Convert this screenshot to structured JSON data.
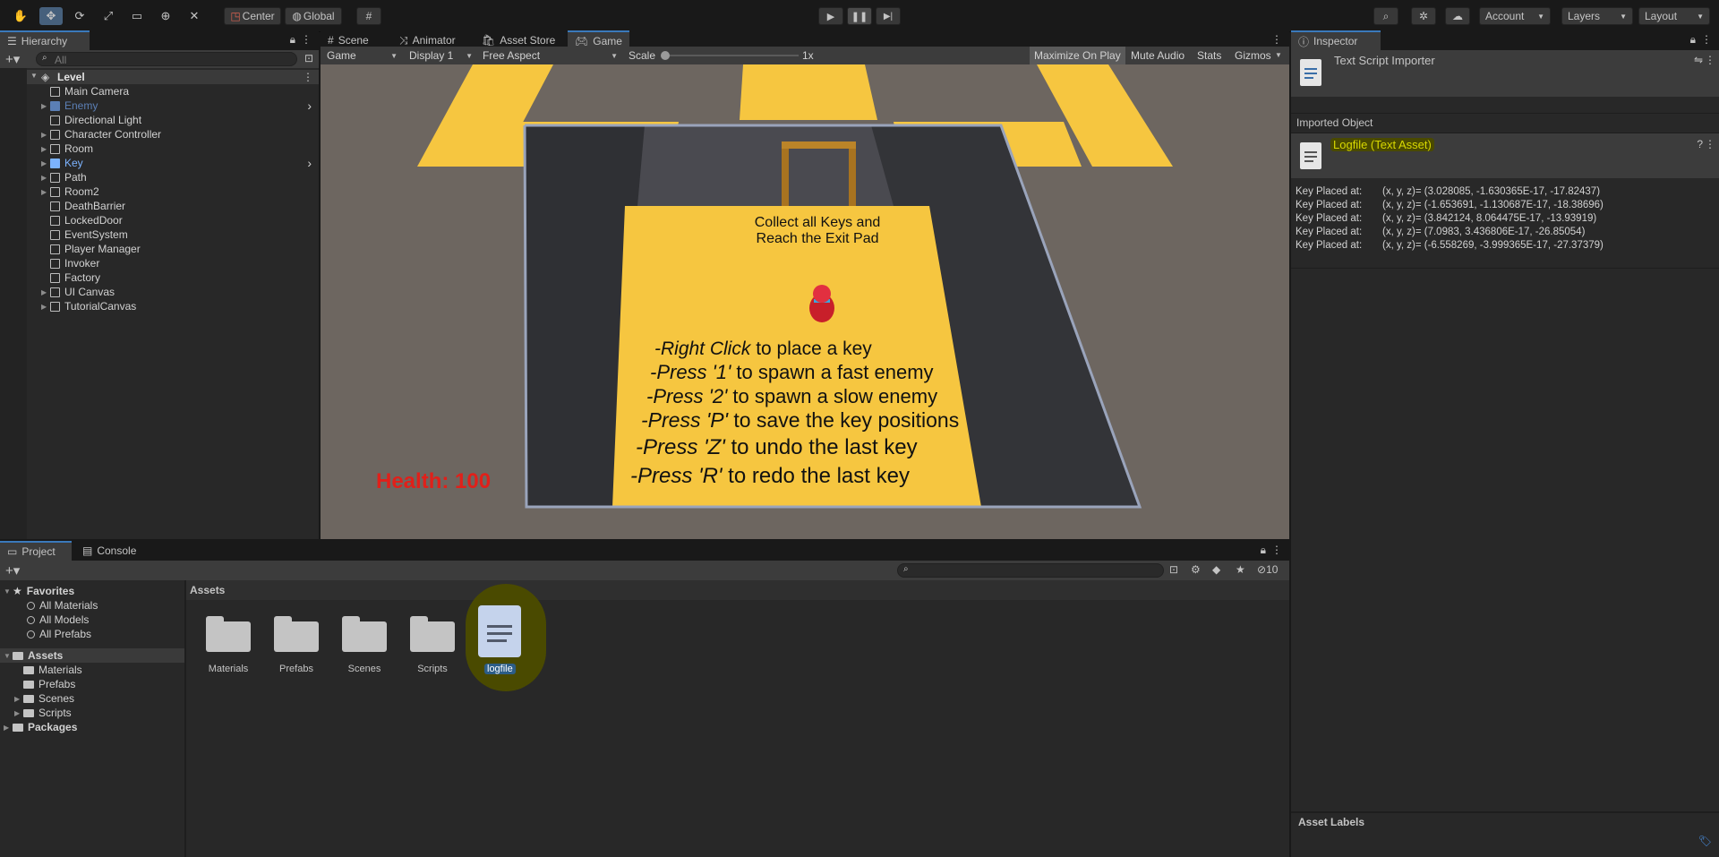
{
  "toolbar": {
    "pivot_label": "Center",
    "space_label": "Global",
    "account_label": "Account",
    "layers_label": "Layers",
    "layout_label": "Layout"
  },
  "hierarchy": {
    "tab_label": "Hierarchy",
    "search_placeholder": "All",
    "root": "Level",
    "items": [
      {
        "label": "Main Camera",
        "expandable": false,
        "color": "#d2d2d2"
      },
      {
        "label": "Enemy",
        "expandable": true,
        "color": "#5b7fb5"
      },
      {
        "label": "Directional Light",
        "expandable": false,
        "color": "#d2d2d2"
      },
      {
        "label": "Character Controller",
        "expandable": true,
        "color": "#d2d2d2"
      },
      {
        "label": "Room",
        "expandable": true,
        "color": "#d2d2d2"
      },
      {
        "label": "Key",
        "expandable": true,
        "color": "#7cb3ff"
      },
      {
        "label": "Path",
        "expandable": true,
        "color": "#d2d2d2"
      },
      {
        "label": "Room2",
        "expandable": true,
        "color": "#d2d2d2"
      },
      {
        "label": "DeathBarrier",
        "expandable": false,
        "color": "#d2d2d2"
      },
      {
        "label": "LockedDoor",
        "expandable": false,
        "color": "#d2d2d2"
      },
      {
        "label": "EventSystem",
        "expandable": false,
        "color": "#d2d2d2"
      },
      {
        "label": "Player Manager",
        "expandable": false,
        "color": "#d2d2d2"
      },
      {
        "label": "Invoker",
        "expandable": false,
        "color": "#d2d2d2"
      },
      {
        "label": "Factory",
        "expandable": false,
        "color": "#d2d2d2"
      },
      {
        "label": "UI Canvas",
        "expandable": true,
        "color": "#d2d2d2"
      },
      {
        "label": "TutorialCanvas",
        "expandable": true,
        "color": "#d2d2d2"
      }
    ]
  },
  "center_tabs": {
    "scene": "Scene",
    "animator": "Animator",
    "asset_store": "Asset Store",
    "game": "Game"
  },
  "game_toolbar": {
    "view": "Game",
    "display": "Display 1",
    "aspect": "Free Aspect",
    "scale_label": "Scale",
    "scale_value": "1x",
    "maximize": "Maximize On Play",
    "mute": "Mute Audio",
    "stats": "Stats",
    "gizmos": "Gizmos"
  },
  "game_view": {
    "objective_line1": "Collect all Keys and",
    "objective_line2": "Reach the Exit Pad",
    "instructions": [
      {
        "italic": "-Right Click",
        "rest": " to place a key"
      },
      {
        "italic": "-Press '1'",
        "rest": " to spawn a fast enemy"
      },
      {
        "italic": "-Press '2'",
        "rest": " to spawn a slow enemy"
      },
      {
        "italic": "-Press 'P'",
        "rest": " to save the key positions"
      },
      {
        "italic": "-Press 'Z'",
        "rest": " to undo the last key"
      },
      {
        "italic": "-Press 'R'",
        "rest": " to redo the last key"
      }
    ],
    "health": "Health: 100"
  },
  "inspector": {
    "tab_label": "Inspector",
    "importer_title": "Text Script Importer",
    "imported_object_label": "Imported Object",
    "asset_title": "Logfile (Text Asset)",
    "log_lines": [
      {
        "prefix": "Key Placed at:",
        "coords": "(x, y, z)= (3.028085, -1.630365E-17, -17.82437)"
      },
      {
        "prefix": "Key Placed at:",
        "coords": "(x, y, z)= (-1.653691, -1.130687E-17, -18.38696)"
      },
      {
        "prefix": "Key Placed at:",
        "coords": "(x, y, z)= (3.842124, 8.064475E-17, -13.93919)"
      },
      {
        "prefix": "Key Placed at:",
        "coords": "(x, y, z)= (7.0983, 3.436806E-17, -26.85054)"
      },
      {
        "prefix": "Key Placed at:",
        "coords": "(x, y, z)= (-6.558269, -3.999365E-17, -27.37379)"
      }
    ],
    "asset_labels": "Asset Labels"
  },
  "project": {
    "tab_project": "Project",
    "tab_console": "Console",
    "hidden_count": "10",
    "favorites_label": "Favorites",
    "favorites": [
      "All Materials",
      "All Models",
      "All Prefabs"
    ],
    "assets_label": "Assets",
    "asset_folders": [
      "Materials",
      "Prefabs",
      "Scenes",
      "Scripts"
    ],
    "packages_label": "Packages",
    "breadcrumb": "Assets",
    "grid_items": [
      "Materials",
      "Prefabs",
      "Scenes",
      "Scripts"
    ],
    "selected_file": "logfile"
  },
  "colors": {
    "accent": "#3a79bb",
    "floor_yellow": "#f6c640",
    "highlight_ring": "#4a4a00",
    "health_red": "#e0201a"
  }
}
